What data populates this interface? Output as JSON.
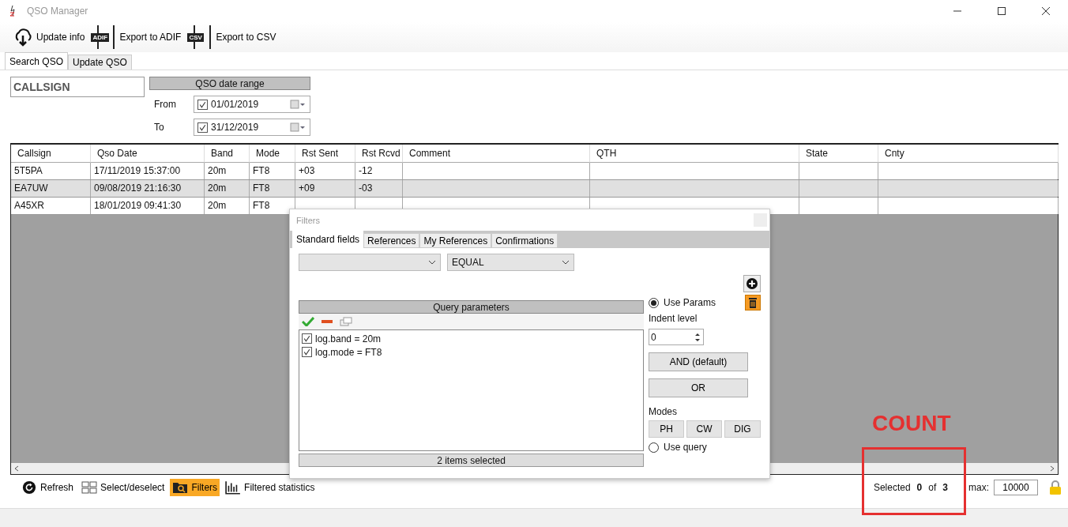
{
  "window": {
    "title": "QSO Manager"
  },
  "toolbar": [
    {
      "kind": "download",
      "label": "Update info"
    },
    {
      "kind": "adif",
      "label": "Export to ADIF",
      "badge": "ADIF"
    },
    {
      "kind": "csv",
      "label": "Export to CSV",
      "badge": "CSV"
    }
  ],
  "tabs": [
    {
      "label": "Search QSO",
      "selected": true
    },
    {
      "label": "Update QSO",
      "selected": false
    }
  ],
  "callsign": {
    "value": "CALLSIGN"
  },
  "date_range": {
    "title": "QSO date range",
    "from": {
      "label": "From",
      "checked": true,
      "value": "01/01/2019"
    },
    "to": {
      "label": "To",
      "checked": true,
      "value": "31/12/2019"
    }
  },
  "table": {
    "columns": [
      "Callsign",
      "Qso Date",
      "Band",
      "Mode",
      "Rst Sent",
      "Rst Rcvd",
      "Comment",
      "QTH",
      "State",
      "Cnty"
    ],
    "rows": [
      {
        "shaded": false,
        "cells": [
          "5T5PA",
          "17/11/2019 15:37:00",
          "20m",
          "FT8",
          "+03",
          "-12",
          "",
          "",
          "",
          ""
        ]
      },
      {
        "shaded": true,
        "cells": [
          "EA7UW",
          "09/08/2019 21:16:30",
          "20m",
          "FT8",
          "+09",
          "-03",
          "",
          "",
          "",
          ""
        ]
      },
      {
        "shaded": false,
        "cells": [
          "A45XR",
          "18/01/2019 09:41:30",
          "20m",
          "FT8",
          "",
          "",
          "",
          "",
          "",
          ""
        ]
      }
    ]
  },
  "dialog": {
    "title": "Filters",
    "tabs": [
      {
        "label": "Standard fields",
        "selected": true
      },
      {
        "label": "References",
        "selected": false
      },
      {
        "label": "My References",
        "selected": false
      },
      {
        "label": "Confirmations",
        "selected": false
      }
    ],
    "operator": "EQUAL",
    "query_header": "Query parameters",
    "params": [
      {
        "text": "log.band = 20m",
        "checked": true
      },
      {
        "text": "log.mode = FT8",
        "checked": true
      }
    ],
    "footer": "2 items selected",
    "use_params": {
      "label": "Use Params",
      "selected": true
    },
    "indent_label": "Indent level",
    "indent_value": "0",
    "logic_buttons": [
      "AND (default)",
      "OR"
    ],
    "modes_label": "Modes",
    "modes": [
      "PH",
      "CW",
      "DIG"
    ],
    "use_query": {
      "label": "Use query",
      "selected": false
    }
  },
  "bottom_bar": {
    "buttons": [
      {
        "kind": "refresh",
        "label": "Refresh",
        "active": false
      },
      {
        "kind": "grid",
        "label": "Select/deselect",
        "active": false
      },
      {
        "kind": "folder",
        "label": "Filters",
        "active": true
      },
      {
        "kind": "stats",
        "label": "Filtered statistics",
        "active": false
      }
    ],
    "selected_label": "Selected",
    "selected_count": "0",
    "of_label": "of",
    "total_count": "3",
    "max_label": "max:",
    "max_value": "10000"
  },
  "annotation": {
    "label": "COUNT"
  }
}
